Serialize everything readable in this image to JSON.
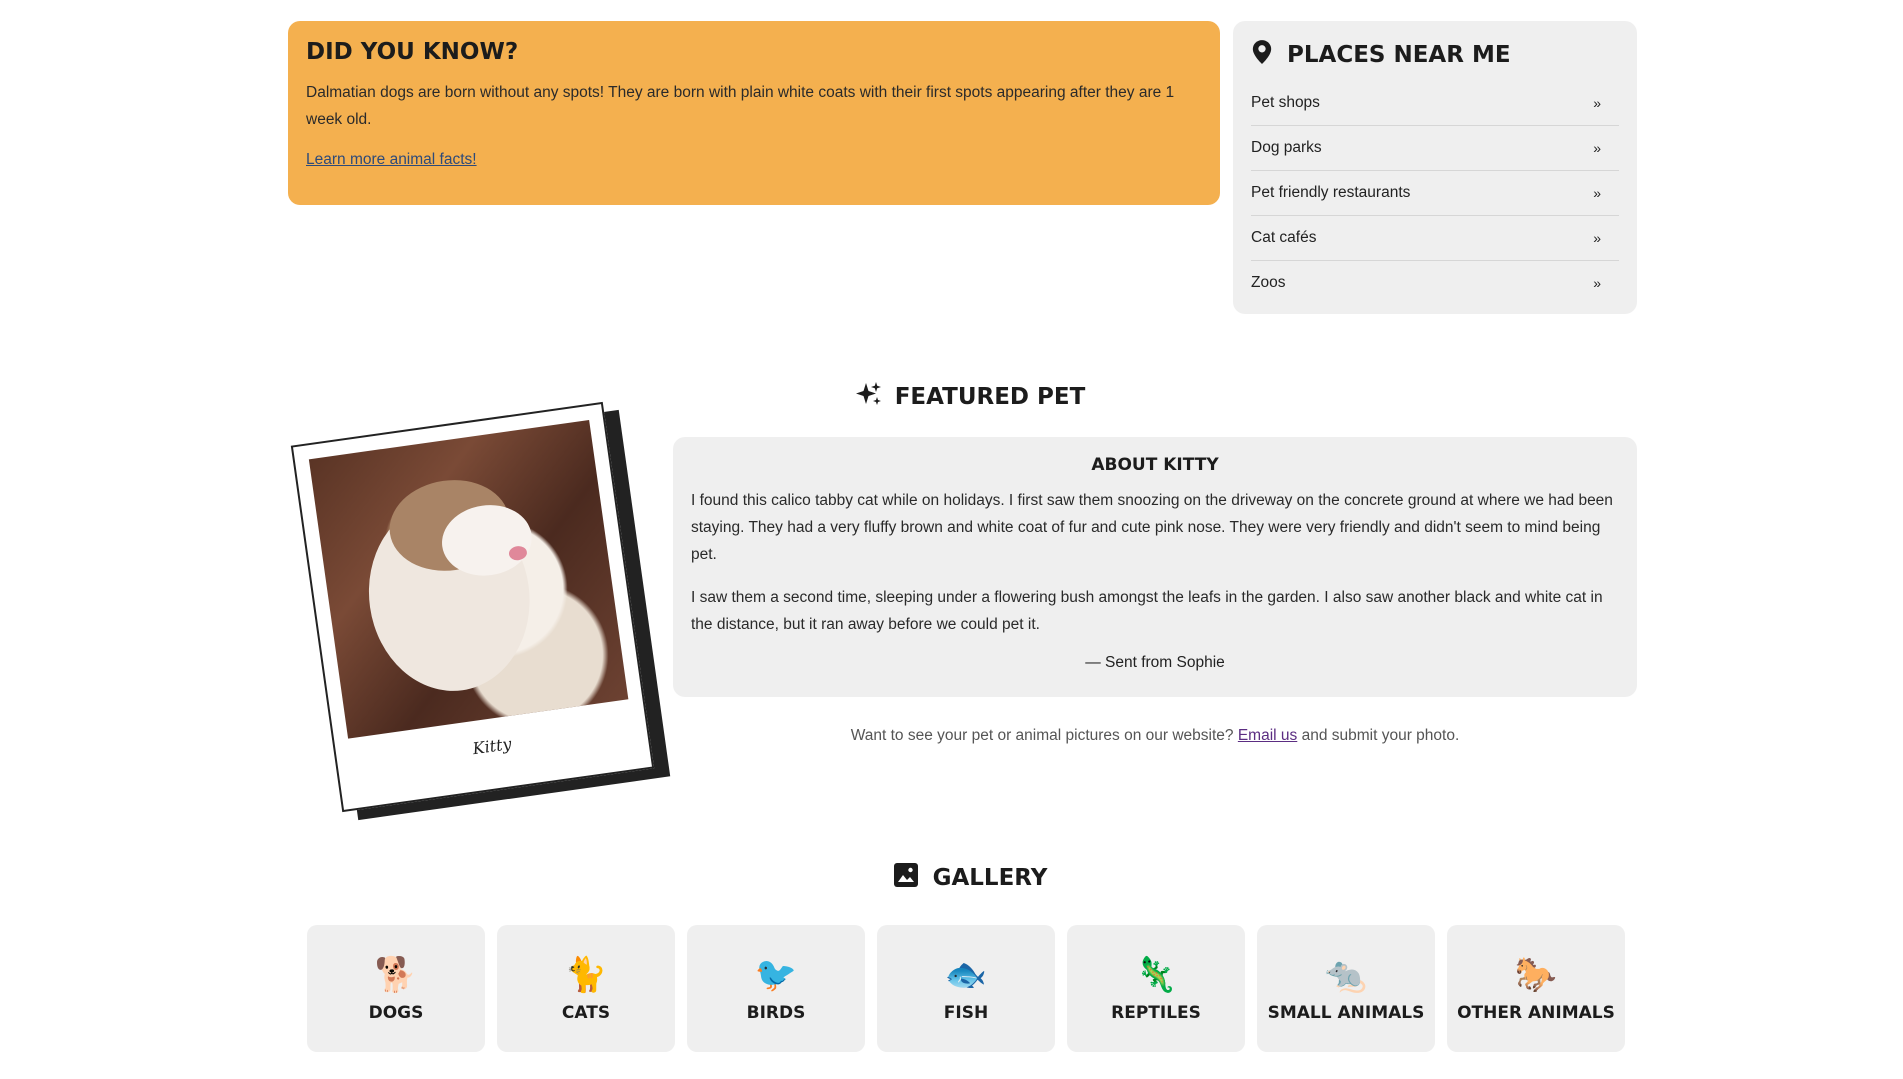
{
  "did_you_know": {
    "title": "DID YOU KNOW?",
    "text": "Dalmatian dogs are born without any spots! They are born with plain white coats with their first spots appearing after they are 1 week old.",
    "link": "Learn more animal facts!"
  },
  "places": {
    "title": "PLACES NEAR ME",
    "icon": "location-pin-icon",
    "items": [
      {
        "label": "Pet shops",
        "chevron": "»"
      },
      {
        "label": "Dog parks",
        "chevron": "»"
      },
      {
        "label": "Pet friendly restaurants",
        "chevron": "»"
      },
      {
        "label": "Cat cafés",
        "chevron": "»"
      },
      {
        "label": "Zoos",
        "chevron": "»"
      }
    ]
  },
  "featured": {
    "title": "FEATURED PET",
    "icon": "sparkles-icon",
    "photo_caption": "Kitty",
    "about_title": "ABOUT KITTY",
    "paragraphs": [
      "I found this calico tabby cat while on holidays. I first saw them snoozing on the driveway on the concrete ground at where we had been staying. They had a very fluffy brown and white coat of fur and cute pink nose. They were very friendly and didn't seem to mind being pet.",
      "I saw them a second time, sleeping under a flowering bush amongst the leafs in the garden. I also saw another black and white cat in the distance, but it ran away before we could pet it."
    ],
    "signature": "— Sent from Sophie",
    "submit_before": "Want to see your pet or animal pictures on our website?",
    "submit_link": "Email us",
    "submit_after": "and submit your photo."
  },
  "gallery": {
    "title": "GALLERY",
    "icon": "image-icon",
    "categories": [
      {
        "emoji": "🐕",
        "label": "DOGS"
      },
      {
        "emoji": "🐈",
        "label": "CATS"
      },
      {
        "emoji": "🐦",
        "label": "BIRDS"
      },
      {
        "emoji": "🐟",
        "label": "FISH"
      },
      {
        "emoji": "🦎",
        "label": "REPTILES"
      },
      {
        "emoji": "🐀",
        "label": "SMALL ANIMALS"
      },
      {
        "emoji": "🐎",
        "label": "OTHER ANIMALS"
      }
    ]
  },
  "colors": {
    "did_you_know_bg": "#f4b04f",
    "panel_bg": "#efefef",
    "link": "#2d4a79",
    "email_link": "#5b2d82"
  }
}
